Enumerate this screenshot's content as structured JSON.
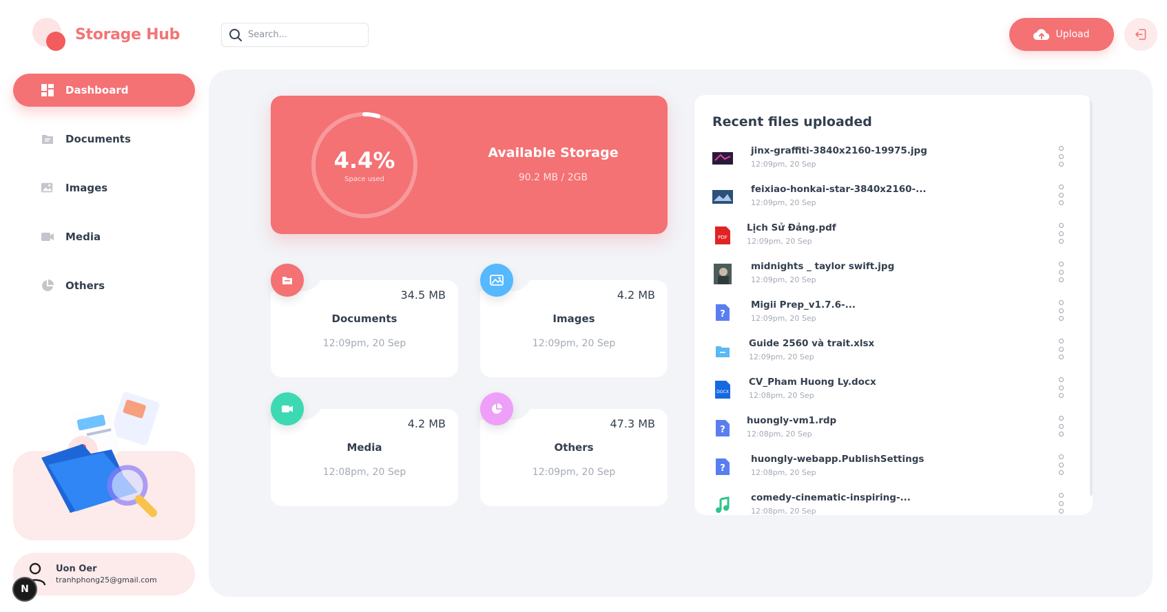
{
  "app": {
    "name": "Storage Hub",
    "brand_color": "#f47174"
  },
  "header": {
    "search_placeholder": "Search...",
    "upload_label": "Upload",
    "upload_icon": "cloud-upload-icon",
    "logout_icon": "logout-icon"
  },
  "sidebar": {
    "items": [
      {
        "label": "Dashboard",
        "icon": "dashboard-grid-icon",
        "active": true
      },
      {
        "label": "Documents",
        "icon": "folder-icon",
        "active": false
      },
      {
        "label": "Images",
        "icon": "image-icon",
        "active": false
      },
      {
        "label": "Media",
        "icon": "video-icon",
        "active": false
      },
      {
        "label": "Others",
        "icon": "pie-chart-icon",
        "active": false
      }
    ],
    "user": {
      "name": "Uon Oer",
      "email": "tranhphong25@gmail.com",
      "badge": "N"
    }
  },
  "storage": {
    "percent_label": "4.4%",
    "percent_value": 0.044,
    "percent_caption": "Space used",
    "title": "Available Storage",
    "value": "90.2 MB / 2GB"
  },
  "types": [
    {
      "label": "Documents",
      "size": "34.5 MB",
      "date": "12:09pm, 20 Sep",
      "color": "#f47174",
      "icon": "document-icon"
    },
    {
      "label": "Images",
      "size": "4.2 MB",
      "date": "12:09pm, 20 Sep",
      "color": "#56b8ff",
      "icon": "image-icon"
    },
    {
      "label": "Media",
      "size": "4.2 MB",
      "date": "12:08pm, 20 Sep",
      "color": "#3dd9b3",
      "icon": "video-icon"
    },
    {
      "label": "Others",
      "size": "47.3 MB",
      "date": "12:09pm, 20 Sep",
      "color": "#ee9ff8",
      "icon": "pie-chart-icon"
    }
  ],
  "recent": {
    "title": "Recent files uploaded",
    "files": [
      {
        "name": "jinx-graffiti-3840x2160-19975.jpg",
        "date": "12:09pm, 20 Sep",
        "icon": "image-thumbnail"
      },
      {
        "name": "feixiao-honkai-star-3840x2160-...",
        "date": "12:09pm, 20 Sep",
        "icon": "image-thumbnail"
      },
      {
        "name": "Lịch Sử Đảng.pdf",
        "date": "12:09pm, 20 Sep",
        "icon": "pdf-file-icon"
      },
      {
        "name": "midnights _ taylor swift.jpg",
        "date": "12:09pm, 20 Sep",
        "icon": "image-thumbnail"
      },
      {
        "name": "Migii Prep_v1.7.6-...",
        "date": "12:09pm, 20 Sep",
        "icon": "unknown-file-icon"
      },
      {
        "name": "Guide 2560 và trait.xlsx",
        "date": "12:09pm, 20 Sep",
        "icon": "spreadsheet-file-icon"
      },
      {
        "name": "CV_Pham Huong Ly.docx",
        "date": "12:08pm, 20 Sep",
        "icon": "docx-file-icon"
      },
      {
        "name": "huongly-vm1.rdp",
        "date": "12:08pm, 20 Sep",
        "icon": "unknown-file-icon"
      },
      {
        "name": "huongly-webapp.PublishSettings",
        "date": "12:08pm, 20 Sep",
        "icon": "unknown-file-icon"
      },
      {
        "name": "comedy-cinematic-inspiring-...",
        "date": "12:08pm, 20 Sep",
        "icon": "audio-file-icon"
      }
    ]
  }
}
